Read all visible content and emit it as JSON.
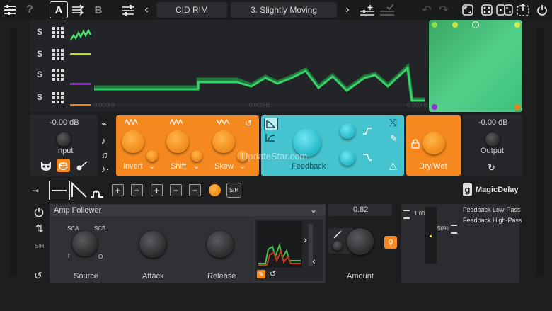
{
  "toolbar": {
    "help": "?",
    "slot_a": "A",
    "slot_b": "B",
    "preset_bank": "CID RIM",
    "preset_name": "3. Slightly Moving"
  },
  "mod_rows": [
    {
      "label": "S",
      "color": "#46e06a"
    },
    {
      "label": "S",
      "color": "#b6e020"
    },
    {
      "label": "S",
      "color": "#9b2bd6"
    },
    {
      "label": "S",
      "color": "#f57f17"
    }
  ],
  "graph_ticks": [
    "0.000Hz",
    "0.000Hz",
    "0.000Hz"
  ],
  "input": {
    "value": "-0.00 dB",
    "label": "Input"
  },
  "output": {
    "value": "-0.00 dB",
    "label": "Output"
  },
  "pitch_module": {
    "invert": "Invert",
    "shift": "Shift",
    "skew": "Skew"
  },
  "feedback_module": {
    "label": "Feedback"
  },
  "drywet": {
    "label": "Dry/Wet"
  },
  "watermark": "UpdateStar.com",
  "slots": {
    "add": "+",
    "sh": "S/H"
  },
  "brand": {
    "logo": "g",
    "name": "MagicDelay"
  },
  "side": {
    "sh": "S/H"
  },
  "follower": {
    "mode": "Amp Follower",
    "sca": "SCA",
    "scb": "SCB",
    "knob_i": "I",
    "knob_o": "O",
    "source": "Source",
    "attack": "Attack",
    "release": "Release"
  },
  "amount": {
    "value": "0.82",
    "label": "Amount"
  },
  "targets": {
    "fader_value": "1.00",
    "fader_pct": "50%",
    "items": [
      "Feedback Low-Pass",
      "Feedback High-Pass"
    ]
  },
  "colors": {
    "orange": "#f5881f",
    "teal": "#45c4cf",
    "xy_green": "#4fc884"
  }
}
